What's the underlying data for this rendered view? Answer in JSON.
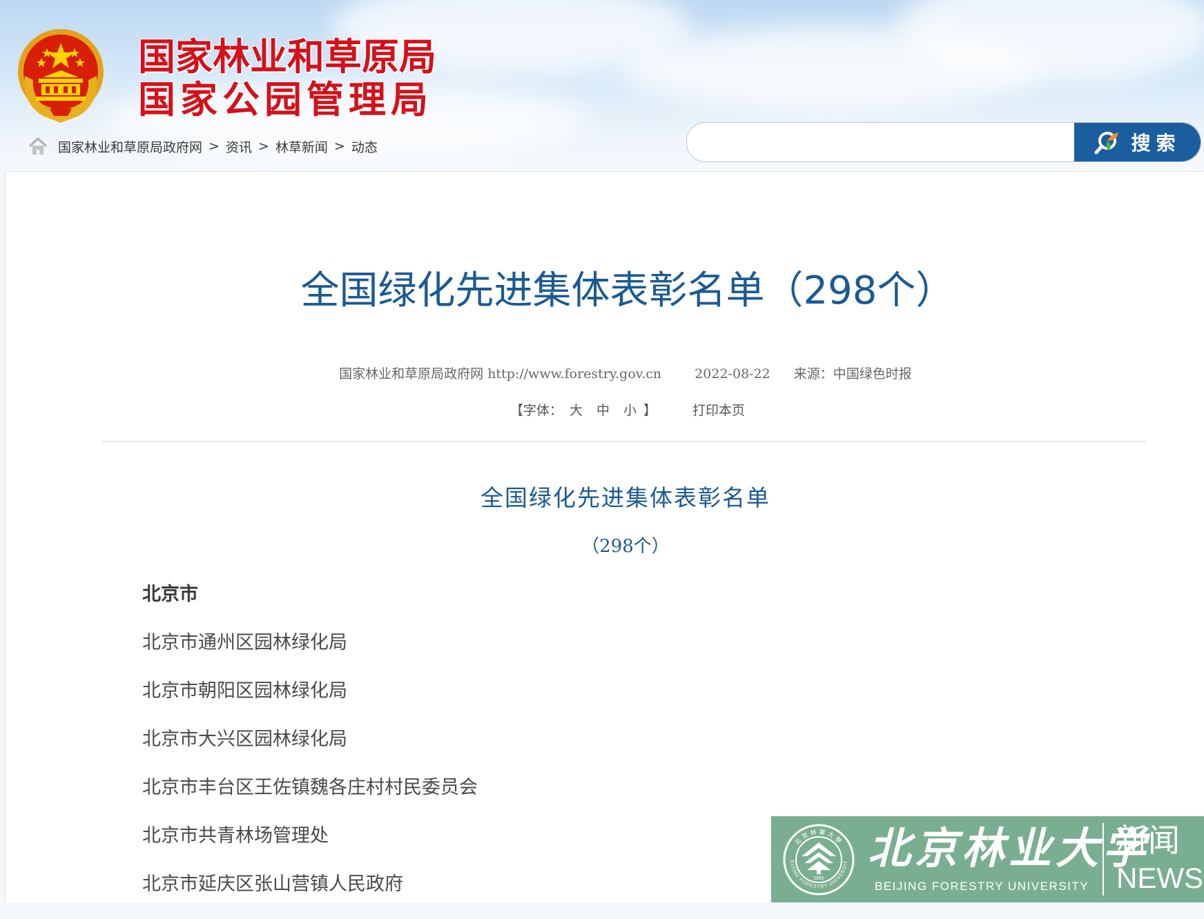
{
  "site": {
    "title_line1": "国家林业和草原局",
    "title_line2": "国家公园管理局",
    "emblem_icon": "national-emblem-icon",
    "brand_color": "#d3121b"
  },
  "breadcrumb": {
    "items": [
      "国家林业和草原局政府网",
      "资讯",
      "林草新闻",
      "动态"
    ],
    "separator": ">"
  },
  "search": {
    "placeholder": "",
    "button_label": "搜索",
    "button_color": "#1b5e9f"
  },
  "article": {
    "title": "全国绿化先进集体表彰名单（298个）",
    "meta": {
      "site": "国家林业和草原局政府网",
      "url": "http://www.forestry.gov.cn",
      "date": "2022-08-22",
      "source": "来源：中国绿色时报"
    },
    "tools": {
      "font_open": "【字体：",
      "font_large": "大",
      "font_medium": "中",
      "font_small": "小",
      "font_close": "】",
      "print": "打印本页"
    },
    "body_title": "全国绿化先进集体表彰名单",
    "body_count": "（298个）",
    "region": "北京市",
    "items": [
      "北京市通州区园林绿化局",
      "北京市朝阳区园林绿化局",
      "北京市大兴区园林绿化局",
      "北京市丰台区王佐镇魏各庄村村民委员会",
      "北京市共青林场管理处",
      "北京市延庆区张山营镇人民政府"
    ],
    "title_color": "#1b5a93"
  },
  "watermark": {
    "name_cn": "北京林业大学",
    "name_en": "BEIJING FORESTRY UNIVERSITY",
    "news_cn": "新闻",
    "news_en": "NEWS",
    "seal_text": "北京林業大學",
    "seal_ring": "BEIJING FORESTRY UNIVERSITY",
    "seal_year": "1952"
  }
}
